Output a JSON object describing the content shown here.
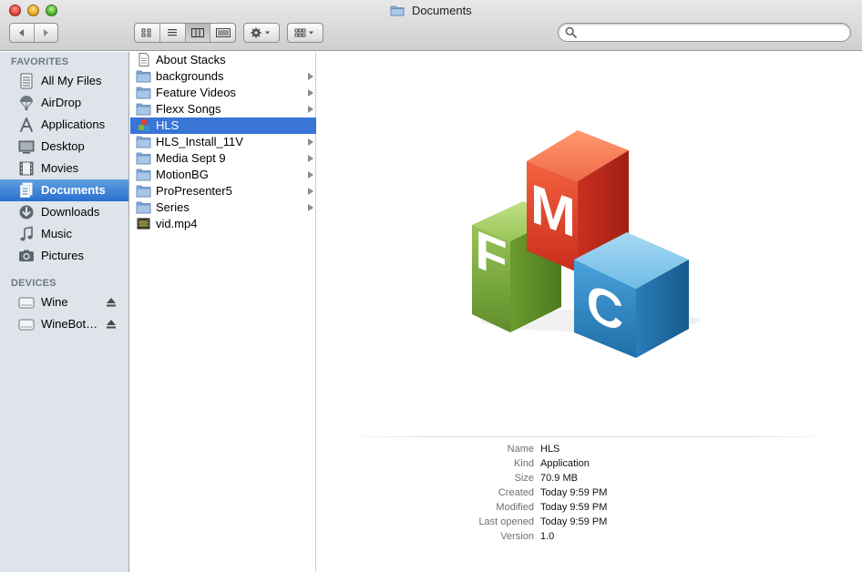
{
  "window": {
    "title": "Documents"
  },
  "toolbar": {
    "search": {
      "placeholder": "",
      "value": ""
    },
    "view_modes": [
      "icon-view",
      "list-view",
      "column-view",
      "coverflow-view"
    ],
    "active_view": "column-view"
  },
  "sidebar": {
    "favorites_header": "FAVORITES",
    "favorites": [
      {
        "label": "All My Files",
        "icon": "all-files-icon"
      },
      {
        "label": "AirDrop",
        "icon": "airdrop-icon"
      },
      {
        "label": "Applications",
        "icon": "applications-icon"
      },
      {
        "label": "Desktop",
        "icon": "desktop-icon"
      },
      {
        "label": "Movies",
        "icon": "movies-icon"
      },
      {
        "label": "Documents",
        "icon": "documents-icon",
        "selected": true
      },
      {
        "label": "Downloads",
        "icon": "downloads-icon"
      },
      {
        "label": "Music",
        "icon": "music-icon"
      },
      {
        "label": "Pictures",
        "icon": "pictures-icon"
      }
    ],
    "devices_header": "DEVICES",
    "devices": [
      {
        "label": "Wine",
        "icon": "drive-icon"
      },
      {
        "label": "WineBot…",
        "icon": "drive-icon"
      }
    ]
  },
  "files": [
    {
      "name": "About Stacks",
      "type": "document"
    },
    {
      "name": "backgrounds",
      "type": "folder"
    },
    {
      "name": "Feature Videos",
      "type": "folder"
    },
    {
      "name": "Flexx Songs",
      "type": "folder"
    },
    {
      "name": "HLS",
      "type": "app",
      "selected": true
    },
    {
      "name": "HLS_Install_11V",
      "type": "folder"
    },
    {
      "name": "Media Sept 9",
      "type": "folder"
    },
    {
      "name": "MotionBG",
      "type": "folder"
    },
    {
      "name": "ProPresenter5",
      "type": "folder"
    },
    {
      "name": "Series",
      "type": "folder"
    },
    {
      "name": "vid.mp4",
      "type": "video"
    }
  ],
  "preview": {
    "letters": {
      "top": "M",
      "left": "F",
      "right": "C"
    },
    "colors": {
      "red": "#e5412c",
      "green": "#7fb13b",
      "blue": "#3b8fc9"
    },
    "info": [
      {
        "key": "Name",
        "value": "HLS"
      },
      {
        "key": "Kind",
        "value": "Application"
      },
      {
        "key": "Size",
        "value": "70.9 MB"
      },
      {
        "key": "Created",
        "value": "Today 9:59 PM"
      },
      {
        "key": "Modified",
        "value": "Today 9:59 PM"
      },
      {
        "key": "Last opened",
        "value": "Today 9:59 PM"
      },
      {
        "key": "Version",
        "value": "1.0"
      }
    ]
  }
}
